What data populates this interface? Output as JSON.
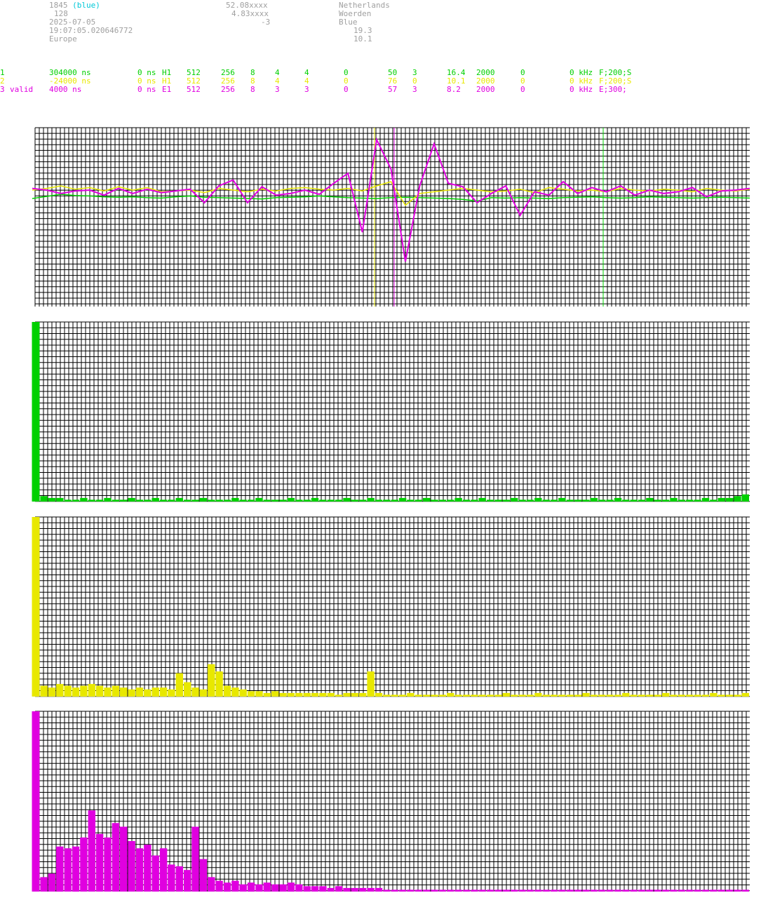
{
  "header": {
    "station_id": "1845",
    "station_color": "(blue)",
    "num": "128",
    "date": "2025-07-05",
    "time": "19:07:05.020646772",
    "region": "Europe",
    "lat": "52.08xxxx",
    "lon": "4.83xxxx",
    "offset": "-3",
    "country": "Netherlands",
    "city": "Woerden",
    "color_name": "Blue",
    "val1": "19.3",
    "val2": "10.1"
  },
  "channels": [
    {
      "id": "1",
      "tag": "",
      "delay": "304000 ns",
      "offset": "0 ns",
      "type": "H1",
      "c1": "512",
      "c2": "256",
      "c3": "8",
      "c4": "4",
      "c5": "4",
      "c6": "0",
      "c7": "50",
      "c8": "3",
      "c9": "16.4",
      "c10": "2000",
      "c11": "0",
      "c12": "0 kHz",
      "filter": "F;200;S",
      "color": "#00d000"
    },
    {
      "id": "2",
      "tag": "",
      "delay": "-24000 ns",
      "offset": "0 ns",
      "type": "H1",
      "c1": "512",
      "c2": "256",
      "c3": "8",
      "c4": "4",
      "c5": "4",
      "c6": "0",
      "c7": "76",
      "c8": "0",
      "c9": "10.1",
      "c10": "2000",
      "c11": "0",
      "c12": "0 kHz",
      "filter": "F;200;S",
      "color": "#e8e800"
    },
    {
      "id": "3",
      "tag": "valid",
      "delay": "4000 ns",
      "offset": "0 ns",
      "type": "E1",
      "c1": "512",
      "c2": "256",
      "c3": "8",
      "c4": "3",
      "c5": "3",
      "c6": "0",
      "c7": "57",
      "c8": "3",
      "c9": "8.2",
      "c10": "2000",
      "c11": "0",
      "c12": "0 kHz",
      "filter": "E;300;",
      "color": "#e000e0"
    }
  ],
  "chart_data": [
    {
      "type": "line",
      "series": [
        {
          "color": "#00d000",
          "values": [
            0,
            0.25,
            0.5,
            0.35,
            0.3,
            0.2,
            0.15,
            0.2,
            0.1,
            0.05,
            0.2,
            0.3,
            0.15,
            0.1,
            0.05,
            0,
            -0.05,
            0.1,
            0.15,
            0.2,
            0.3,
            0.2,
            0.1,
            0.05,
            0,
            0.1,
            0.15,
            0.1,
            0.05,
            0,
            -0.1,
            -0.3,
            0.1,
            0.05,
            0.1,
            0.05,
            0,
            0.1,
            0.15,
            0.2,
            0.1,
            0.05,
            0.1,
            0.2,
            0.15,
            0.1,
            0.05,
            0.1,
            0.15,
            0.1,
            0.05
          ]
        },
        {
          "color": "#e8e800",
          "values": [
            1,
            1.2,
            1.5,
            1.1,
            1.3,
            0.9,
            1.4,
            1.0,
            1.3,
            0.8,
            0.9,
            1.0,
            0.7,
            1.2,
            1.0,
            0.8,
            1.1,
            0.9,
            1.2,
            1.3,
            1.1,
            1.0,
            1.2,
            0.9,
            1.5,
            2.0,
            -0.8,
            0.6,
            0.8,
            1.0,
            1.2,
            1.0,
            0.8,
            0.9,
            1.1,
            0.7,
            1.3,
            1.1,
            0.9,
            1.0,
            0.8,
            1.2,
            1.0,
            0.9,
            1.1,
            1.0,
            0.8,
            1.2,
            1.0,
            0.9,
            1.1
          ]
        },
        {
          "color": "#e000e0",
          "values": [
            1.2,
            1.0,
            0.6,
            0.9,
            1.0,
            0.4,
            1.2,
            0.6,
            1.1,
            0.7,
            0.9,
            1.1,
            -0.5,
            1.5,
            2.2,
            -0.5,
            1.4,
            0.4,
            0.6,
            1.0,
            0.5,
            1.8,
            3.0,
            -4.0,
            7.0,
            3.5,
            -7.5,
            1.5,
            6.5,
            1.8,
            1.4,
            -0.5,
            0.6,
            1.5,
            -2.0,
            0.8,
            0.4,
            2.0,
            0.6,
            1.3,
            0.8,
            1.5,
            0.4,
            1.0,
            0.6,
            0.8,
            1.3,
            0.2,
            0.9,
            1.0,
            1.2
          ]
        }
      ]
    },
    {
      "type": "bar",
      "color": "#00d000",
      "values": [
        100,
        3,
        2,
        2,
        1,
        1,
        2,
        1,
        1,
        2,
        1,
        1,
        2,
        1,
        1,
        2,
        1,
        1,
        2,
        1,
        1,
        2,
        1,
        1,
        1,
        2,
        1,
        1,
        2,
        1,
        1,
        1,
        2,
        1,
        1,
        2,
        1,
        1,
        1,
        2,
        1,
        1,
        2,
        1,
        1,
        1,
        2,
        1,
        1,
        2,
        1,
        1,
        1,
        2,
        1,
        1,
        2,
        1,
        1,
        1,
        2,
        1,
        1,
        2,
        1,
        1,
        2,
        1,
        1,
        1,
        2,
        1,
        1,
        2,
        1,
        1,
        1,
        2,
        1,
        1,
        2,
        1,
        1,
        1,
        2,
        1,
        2,
        2,
        3,
        4
      ]
    },
    {
      "type": "bar",
      "color": "#e8e800",
      "values": [
        100,
        6,
        5,
        7,
        6,
        5,
        6,
        7,
        6,
        5,
        6,
        5,
        4,
        5,
        4,
        5,
        5,
        4,
        13,
        8,
        5,
        4,
        18,
        14,
        6,
        5,
        4,
        3,
        3,
        2,
        3,
        2,
        2,
        2,
        2,
        2,
        2,
        2,
        1,
        2,
        2,
        2,
        14,
        2,
        1,
        1,
        1,
        2,
        1,
        1,
        1,
        1,
        2,
        1,
        1,
        1,
        1,
        1,
        1,
        2,
        1,
        1,
        1,
        2,
        1,
        1,
        1,
        1,
        1,
        2,
        1,
        1,
        1,
        1,
        2,
        1,
        1,
        1,
        1,
        2,
        1,
        1,
        1,
        1,
        1,
        2,
        1,
        1,
        1,
        2
      ]
    },
    {
      "type": "bar",
      "color": "#e000e0",
      "values": [
        100,
        8,
        10,
        25,
        24,
        25,
        30,
        45,
        32,
        30,
        38,
        36,
        28,
        24,
        26,
        20,
        24,
        15,
        14,
        12,
        36,
        18,
        8,
        6,
        5,
        6,
        4,
        5,
        4,
        5,
        4,
        4,
        5,
        4,
        3,
        3,
        3,
        2,
        3,
        2,
        2,
        2,
        2,
        2,
        1,
        1,
        1,
        1,
        1,
        1,
        1,
        1,
        1,
        1,
        1,
        1,
        1,
        1,
        1,
        1,
        1,
        1,
        1,
        1,
        1,
        1,
        1,
        1,
        1,
        1,
        1,
        1,
        1,
        1,
        1,
        1,
        1,
        1,
        1,
        1,
        1,
        1,
        1,
        1,
        1,
        1,
        1,
        1,
        1,
        1
      ]
    }
  ]
}
